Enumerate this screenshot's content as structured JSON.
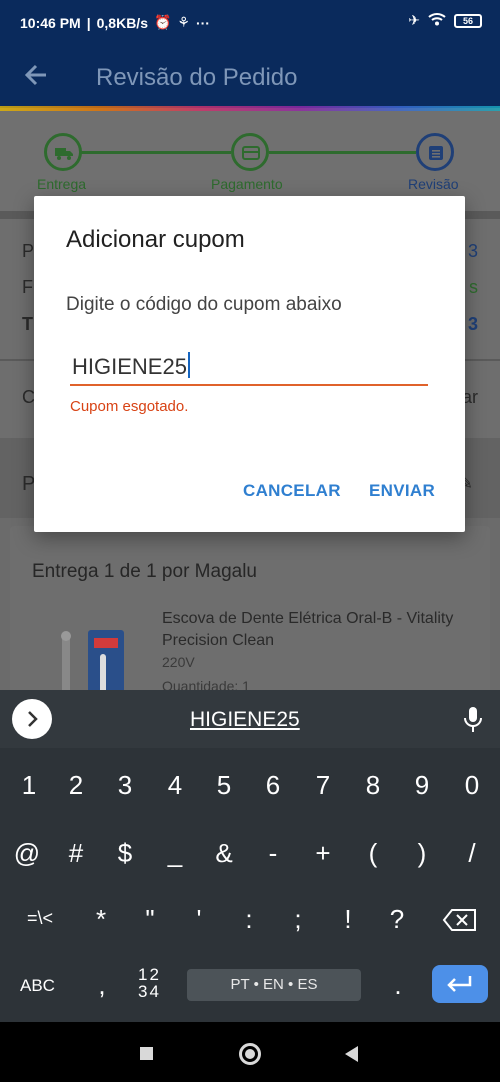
{
  "status_bar": {
    "time": "10:46 PM",
    "net_speed": "0,8KB/s",
    "battery": "56"
  },
  "app_bar": {
    "title": "Revisão do Pedido"
  },
  "steps": [
    {
      "label": "Entrega"
    },
    {
      "label": "Pagamento"
    },
    {
      "label": "Revisão"
    }
  ],
  "summary": {
    "row_p": "P",
    "row_f": "F",
    "row_t": "T",
    "val_p": "3",
    "val_f": "s",
    "val_t": "3",
    "row_c": "C",
    "row_c_right": "ar",
    "section_p": "P"
  },
  "card": {
    "delivery": "Entrega 1 de 1 por Magalu",
    "product_name": "Escova de Dente Elétrica Oral-B - Vitality Precision Clean",
    "voltage": "220V",
    "quantity": "Quantidade: 1"
  },
  "dialog": {
    "title": "Adicionar cupom",
    "message": "Digite o código do cupom abaixo",
    "input_value": "HIGIENE25",
    "error": "Cupom esgotado.",
    "cancel_label": "CANCELAR",
    "submit_label": "ENVIAR"
  },
  "keyboard": {
    "suggestion": "HIGIENE25",
    "row1": [
      "1",
      "2",
      "3",
      "4",
      "5",
      "6",
      "7",
      "8",
      "9",
      "0"
    ],
    "row2": [
      "@",
      "#",
      "$",
      "_",
      "&",
      "-",
      "+",
      "(",
      ")",
      "/"
    ],
    "row3": [
      "=\\<",
      "*",
      "\"",
      "'",
      ":",
      ";",
      "!",
      "?"
    ],
    "abc": "ABC",
    "comma": ",",
    "num_top": "12",
    "num_bottom": "34",
    "space": "PT • EN • ES",
    "period": "."
  },
  "colors": {
    "app_bar": "#0a2a5c",
    "error": "#d84315",
    "accent": "#2f7fd0",
    "enter": "#4d90e8"
  }
}
